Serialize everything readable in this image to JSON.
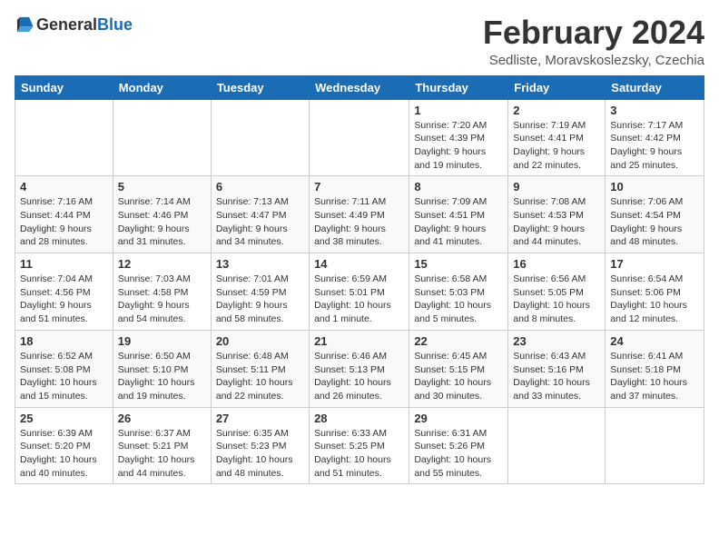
{
  "header": {
    "logo_general": "General",
    "logo_blue": "Blue",
    "title": "February 2024",
    "subtitle": "Sedliste, Moravskoslezsky, Czechia"
  },
  "weekdays": [
    "Sunday",
    "Monday",
    "Tuesday",
    "Wednesday",
    "Thursday",
    "Friday",
    "Saturday"
  ],
  "weeks": [
    [
      {
        "day": "",
        "info": ""
      },
      {
        "day": "",
        "info": ""
      },
      {
        "day": "",
        "info": ""
      },
      {
        "day": "",
        "info": ""
      },
      {
        "day": "1",
        "info": "Sunrise: 7:20 AM\nSunset: 4:39 PM\nDaylight: 9 hours\nand 19 minutes."
      },
      {
        "day": "2",
        "info": "Sunrise: 7:19 AM\nSunset: 4:41 PM\nDaylight: 9 hours\nand 22 minutes."
      },
      {
        "day": "3",
        "info": "Sunrise: 7:17 AM\nSunset: 4:42 PM\nDaylight: 9 hours\nand 25 minutes."
      }
    ],
    [
      {
        "day": "4",
        "info": "Sunrise: 7:16 AM\nSunset: 4:44 PM\nDaylight: 9 hours\nand 28 minutes."
      },
      {
        "day": "5",
        "info": "Sunrise: 7:14 AM\nSunset: 4:46 PM\nDaylight: 9 hours\nand 31 minutes."
      },
      {
        "day": "6",
        "info": "Sunrise: 7:13 AM\nSunset: 4:47 PM\nDaylight: 9 hours\nand 34 minutes."
      },
      {
        "day": "7",
        "info": "Sunrise: 7:11 AM\nSunset: 4:49 PM\nDaylight: 9 hours\nand 38 minutes."
      },
      {
        "day": "8",
        "info": "Sunrise: 7:09 AM\nSunset: 4:51 PM\nDaylight: 9 hours\nand 41 minutes."
      },
      {
        "day": "9",
        "info": "Sunrise: 7:08 AM\nSunset: 4:53 PM\nDaylight: 9 hours\nand 44 minutes."
      },
      {
        "day": "10",
        "info": "Sunrise: 7:06 AM\nSunset: 4:54 PM\nDaylight: 9 hours\nand 48 minutes."
      }
    ],
    [
      {
        "day": "11",
        "info": "Sunrise: 7:04 AM\nSunset: 4:56 PM\nDaylight: 9 hours\nand 51 minutes."
      },
      {
        "day": "12",
        "info": "Sunrise: 7:03 AM\nSunset: 4:58 PM\nDaylight: 9 hours\nand 54 minutes."
      },
      {
        "day": "13",
        "info": "Sunrise: 7:01 AM\nSunset: 4:59 PM\nDaylight: 9 hours\nand 58 minutes."
      },
      {
        "day": "14",
        "info": "Sunrise: 6:59 AM\nSunset: 5:01 PM\nDaylight: 10 hours\nand 1 minute."
      },
      {
        "day": "15",
        "info": "Sunrise: 6:58 AM\nSunset: 5:03 PM\nDaylight: 10 hours\nand 5 minutes."
      },
      {
        "day": "16",
        "info": "Sunrise: 6:56 AM\nSunset: 5:05 PM\nDaylight: 10 hours\nand 8 minutes."
      },
      {
        "day": "17",
        "info": "Sunrise: 6:54 AM\nSunset: 5:06 PM\nDaylight: 10 hours\nand 12 minutes."
      }
    ],
    [
      {
        "day": "18",
        "info": "Sunrise: 6:52 AM\nSunset: 5:08 PM\nDaylight: 10 hours\nand 15 minutes."
      },
      {
        "day": "19",
        "info": "Sunrise: 6:50 AM\nSunset: 5:10 PM\nDaylight: 10 hours\nand 19 minutes."
      },
      {
        "day": "20",
        "info": "Sunrise: 6:48 AM\nSunset: 5:11 PM\nDaylight: 10 hours\nand 22 minutes."
      },
      {
        "day": "21",
        "info": "Sunrise: 6:46 AM\nSunset: 5:13 PM\nDaylight: 10 hours\nand 26 minutes."
      },
      {
        "day": "22",
        "info": "Sunrise: 6:45 AM\nSunset: 5:15 PM\nDaylight: 10 hours\nand 30 minutes."
      },
      {
        "day": "23",
        "info": "Sunrise: 6:43 AM\nSunset: 5:16 PM\nDaylight: 10 hours\nand 33 minutes."
      },
      {
        "day": "24",
        "info": "Sunrise: 6:41 AM\nSunset: 5:18 PM\nDaylight: 10 hours\nand 37 minutes."
      }
    ],
    [
      {
        "day": "25",
        "info": "Sunrise: 6:39 AM\nSunset: 5:20 PM\nDaylight: 10 hours\nand 40 minutes."
      },
      {
        "day": "26",
        "info": "Sunrise: 6:37 AM\nSunset: 5:21 PM\nDaylight: 10 hours\nand 44 minutes."
      },
      {
        "day": "27",
        "info": "Sunrise: 6:35 AM\nSunset: 5:23 PM\nDaylight: 10 hours\nand 48 minutes."
      },
      {
        "day": "28",
        "info": "Sunrise: 6:33 AM\nSunset: 5:25 PM\nDaylight: 10 hours\nand 51 minutes."
      },
      {
        "day": "29",
        "info": "Sunrise: 6:31 AM\nSunset: 5:26 PM\nDaylight: 10 hours\nand 55 minutes."
      },
      {
        "day": "",
        "info": ""
      },
      {
        "day": "",
        "info": ""
      }
    ]
  ]
}
